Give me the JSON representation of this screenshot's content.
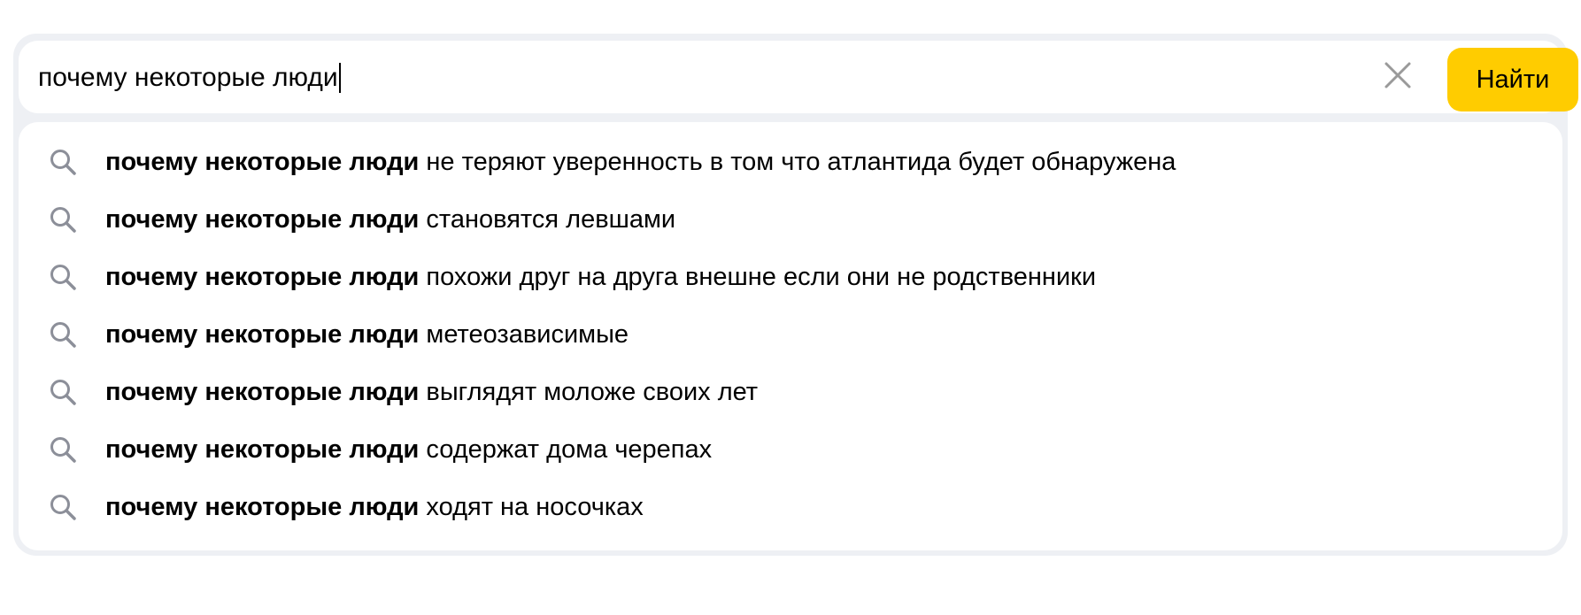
{
  "search": {
    "query": "почему некоторые люди",
    "clear_icon": "close-icon",
    "submit_label": "Найти",
    "accent_color": "#ffcc00"
  },
  "suggestions": {
    "icon": "search-icon",
    "items": [
      {
        "bold": "почему некоторые люди",
        "rest": " не теряют уверенность в том что атлантида будет обнаружена"
      },
      {
        "bold": "почему некоторые люди",
        "rest": " становятся левшами"
      },
      {
        "bold": "почему некоторые люди",
        "rest": " похожи друг на друга внешне если они не родственники"
      },
      {
        "bold": "почему некоторые люди",
        "rest": " метеозависимые"
      },
      {
        "bold": "почему некоторые люди",
        "rest": " выглядят моложе своих лет"
      },
      {
        "bold": "почему некоторые люди",
        "rest": " содержат дома черепах"
      },
      {
        "bold": "почему некоторые люди",
        "rest": " ходят на носочках"
      }
    ]
  }
}
